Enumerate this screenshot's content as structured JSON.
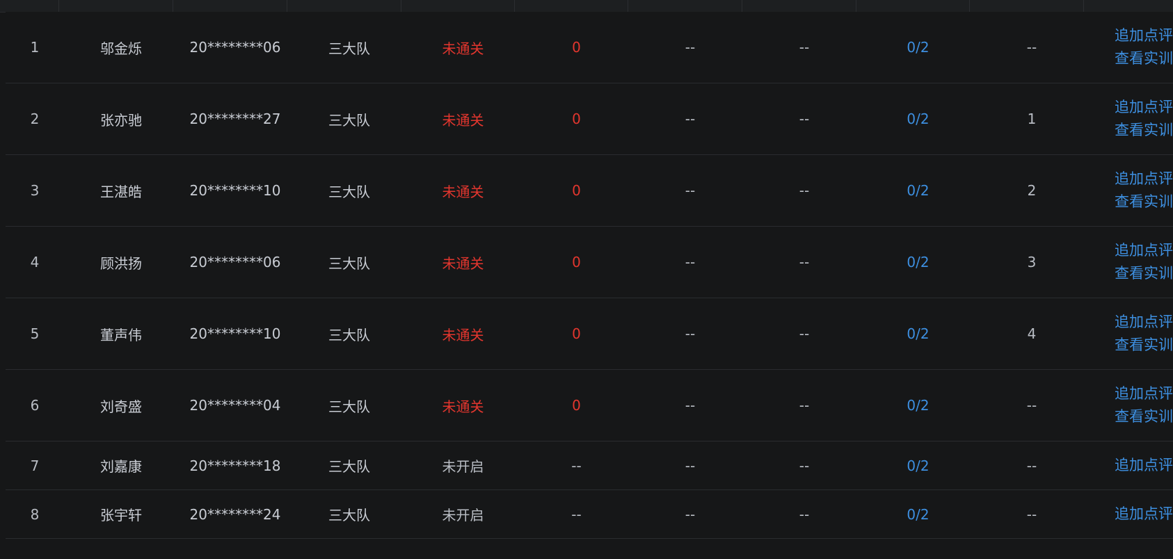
{
  "rows": [
    {
      "index": "1",
      "name": "邬金烁",
      "student_id": "20********06",
      "team": "三大队",
      "status": "未通关",
      "score": "0",
      "col_a": "--",
      "col_b": "--",
      "progress": "0/2",
      "rank": "--",
      "actions": [
        "追加点评",
        "查看实训"
      ]
    },
    {
      "index": "2",
      "name": "张亦驰",
      "student_id": "20********27",
      "team": "三大队",
      "status": "未通关",
      "score": "0",
      "col_a": "--",
      "col_b": "--",
      "progress": "0/2",
      "rank": "1",
      "actions": [
        "追加点评",
        "查看实训"
      ]
    },
    {
      "index": "3",
      "name": "王湛皓",
      "student_id": "20********10",
      "team": "三大队",
      "status": "未通关",
      "score": "0",
      "col_a": "--",
      "col_b": "--",
      "progress": "0/2",
      "rank": "2",
      "actions": [
        "追加点评",
        "查看实训"
      ]
    },
    {
      "index": "4",
      "name": "顾洪扬",
      "student_id": "20********06",
      "team": "三大队",
      "status": "未通关",
      "score": "0",
      "col_a": "--",
      "col_b": "--",
      "progress": "0/2",
      "rank": "3",
      "actions": [
        "追加点评",
        "查看实训"
      ]
    },
    {
      "index": "5",
      "name": "董声伟",
      "student_id": "20********10",
      "team": "三大队",
      "status": "未通关",
      "score": "0",
      "col_a": "--",
      "col_b": "--",
      "progress": "0/2",
      "rank": "4",
      "actions": [
        "追加点评",
        "查看实训"
      ]
    },
    {
      "index": "6",
      "name": "刘奇盛",
      "student_id": "20********04",
      "team": "三大队",
      "status": "未通关",
      "score": "0",
      "col_a": "--",
      "col_b": "--",
      "progress": "0/2",
      "rank": "--",
      "actions": [
        "追加点评",
        "查看实训"
      ]
    },
    {
      "index": "7",
      "name": "刘嘉康",
      "student_id": "20********18",
      "team": "三大队",
      "status": "未开启",
      "score": "--",
      "col_a": "--",
      "col_b": "--",
      "progress": "0/2",
      "rank": "--",
      "actions": [
        "追加点评"
      ]
    },
    {
      "index": "8",
      "name": "张宇轩",
      "student_id": "20********24",
      "team": "三大队",
      "status": "未开启",
      "score": "--",
      "col_a": "--",
      "col_b": "--",
      "progress": "0/2",
      "rank": "--",
      "actions": [
        "追加点评"
      ]
    }
  ],
  "colors": {
    "background": "#161718",
    "text": "#c9cdd4",
    "status_fail": "#e3362e",
    "link": "#3d8fe0",
    "border": "#2a2c2f"
  }
}
